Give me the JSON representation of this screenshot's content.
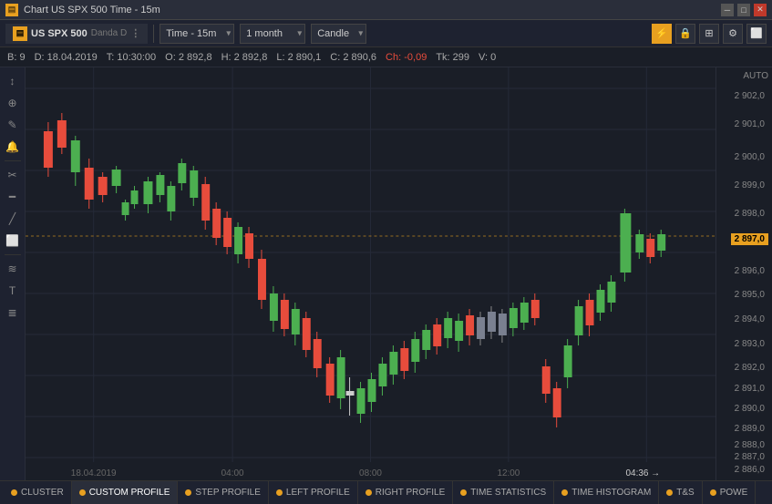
{
  "titlebar": {
    "title": "Chart US SPX 500 Time - 15m",
    "icon": "▤",
    "close_label": "✕",
    "max_label": "□",
    "min_label": "─"
  },
  "toolbar": {
    "symbol": "US SPX 500",
    "exchange": "Danda D",
    "timeframe": "Time - 15m",
    "period": "1 month",
    "chart_type": "Candle",
    "more_icon": "⋮"
  },
  "infobar": {
    "b_label": "B:",
    "b_value": "9",
    "d_label": "D:",
    "d_value": "18.04.2019",
    "t_label": "T:",
    "t_value": "10:30:00",
    "o_label": "O:",
    "o_value": "2 892,8",
    "h_label": "H:",
    "h_value": "2 892,8",
    "l_label": "L:",
    "l_value": "2 890,1",
    "c_label": "C:",
    "c_value": "2 890,6",
    "ch_label": "Ch:",
    "ch_value": "-0,09",
    "tk_label": "Tk:",
    "tk_value": "299",
    "v_label": "V:",
    "v_value": "0"
  },
  "price_axis": {
    "auto_label": "AUTO",
    "current_price": "2 897,0",
    "prices": [
      {
        "value": "2 902,0",
        "pct": 5
      },
      {
        "value": "2 901,0",
        "pct": 12
      },
      {
        "value": "2 900,0",
        "pct": 20
      },
      {
        "value": "2 899,0",
        "pct": 27
      },
      {
        "value": "2 898,0",
        "pct": 35
      },
      {
        "value": "2 897,0",
        "pct": 43
      },
      {
        "value": "2 896,0",
        "pct": 50
      },
      {
        "value": "2 895,0",
        "pct": 57
      },
      {
        "value": "2 894,0",
        "pct": 62
      },
      {
        "value": "2 893,0",
        "pct": 68
      },
      {
        "value": "2 892,0",
        "pct": 73
      },
      {
        "value": "2 891,0",
        "pct": 78
      },
      {
        "value": "2 890,0",
        "pct": 83
      },
      {
        "value": "2 889,0",
        "pct": 87
      },
      {
        "value": "2 888,0",
        "pct": 91
      },
      {
        "value": "2 887,0",
        "pct": 95
      },
      {
        "value": "2 886,0",
        "pct": 99
      }
    ]
  },
  "time_axis": {
    "labels": [
      {
        "text": "18.04.2019",
        "pct": 10
      },
      {
        "text": "04:00",
        "pct": 30
      },
      {
        "text": "08:00",
        "pct": 55
      },
      {
        "text": "12:00",
        "pct": 78
      }
    ],
    "current_time": "04:36",
    "arrow": "→"
  },
  "bottom_tabs": [
    {
      "label": "CLUSTER",
      "dot_color": "orange"
    },
    {
      "label": "CUSTOM PROFILE",
      "dot_color": "orange"
    },
    {
      "label": "STEP PROFILE",
      "dot_color": "orange"
    },
    {
      "label": "LEFT PROFILE",
      "dot_color": "orange"
    },
    {
      "label": "RIGHT PROFILE",
      "dot_color": "orange"
    },
    {
      "label": "TIME STATISTICS",
      "dot_color": "orange"
    },
    {
      "label": "TIME HISTOGRAM",
      "dot_color": "orange"
    },
    {
      "label": "T&S",
      "dot_color": "orange"
    },
    {
      "label": "POWE",
      "dot_color": "orange"
    }
  ],
  "left_toolbar": {
    "buttons": [
      {
        "icon": "↕",
        "name": "cursor-tool"
      },
      {
        "icon": "⊕",
        "name": "crosshair-tool"
      },
      {
        "icon": "✎",
        "name": "draw-tool"
      },
      {
        "icon": "🔔",
        "name": "alert-tool"
      },
      {
        "icon": "✂",
        "name": "cut-tool"
      },
      {
        "icon": "━",
        "name": "hline-tool"
      },
      {
        "icon": "╱",
        "name": "trendline-tool"
      },
      {
        "icon": "⬜",
        "name": "rect-tool"
      },
      {
        "icon": "Ⅲ",
        "name": "fib-tool"
      },
      {
        "icon": "≡",
        "name": "text-tool"
      },
      {
        "icon": "≣",
        "name": "menu-tool"
      }
    ]
  },
  "colors": {
    "bg": "#1a1e27",
    "toolbar_bg": "#1e2230",
    "accent_orange": "#e8a020",
    "candle_up": "#4caf50",
    "candle_down": "#e74c3c",
    "grid": "#252a38",
    "price_current_bg": "#e8a020"
  }
}
